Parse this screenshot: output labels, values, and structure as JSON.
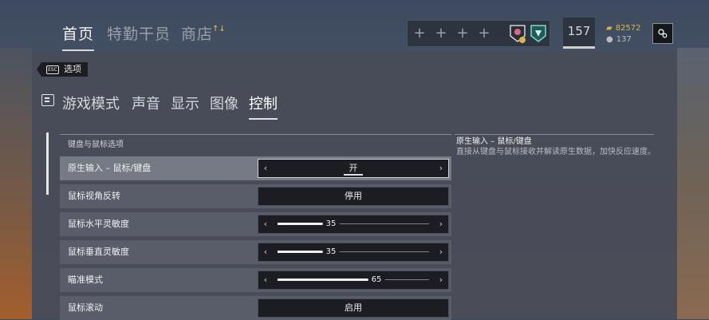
{
  "nav": {
    "tabs": [
      "首页",
      "特勤干员",
      "商店"
    ],
    "shop_badge": "↑↓"
  },
  "header": {
    "level": "157",
    "currency_gold": "82572",
    "currency_silver": "137",
    "slot_glyph": "+"
  },
  "back": {
    "key": "ESC",
    "label": "选项"
  },
  "subtabs": [
    "游戏模式",
    "声音",
    "显示",
    "图像",
    "控制"
  ],
  "group": {
    "label": "键盘与鼠标选项"
  },
  "rows": [
    {
      "label": "原生输入 – 鼠标/键盘",
      "kind": "option",
      "value": "开"
    },
    {
      "label": "鼠标视角反转",
      "kind": "button",
      "value": "停用"
    },
    {
      "label": "鼠标水平灵敏度",
      "kind": "slider",
      "value": "35",
      "level": 0.35
    },
    {
      "label": "鼠标垂直灵敏度",
      "kind": "slider",
      "value": "35",
      "level": 0.35
    },
    {
      "label": "瞄准模式",
      "kind": "slider",
      "value": "65",
      "level": 0.65
    },
    {
      "label": "鼠标滚动",
      "kind": "button",
      "value": "启用"
    }
  ],
  "info": {
    "title": "原生输入 – 鼠标/键盘",
    "desc": "直接从键盘与鼠标接收并解读原生数据，加快反应速度。"
  },
  "icons": [
    "gear-icon",
    "esc-key-icon",
    "controls-section-icon",
    "left-arrow-icon",
    "right-arrow-icon",
    "plus-icon"
  ]
}
